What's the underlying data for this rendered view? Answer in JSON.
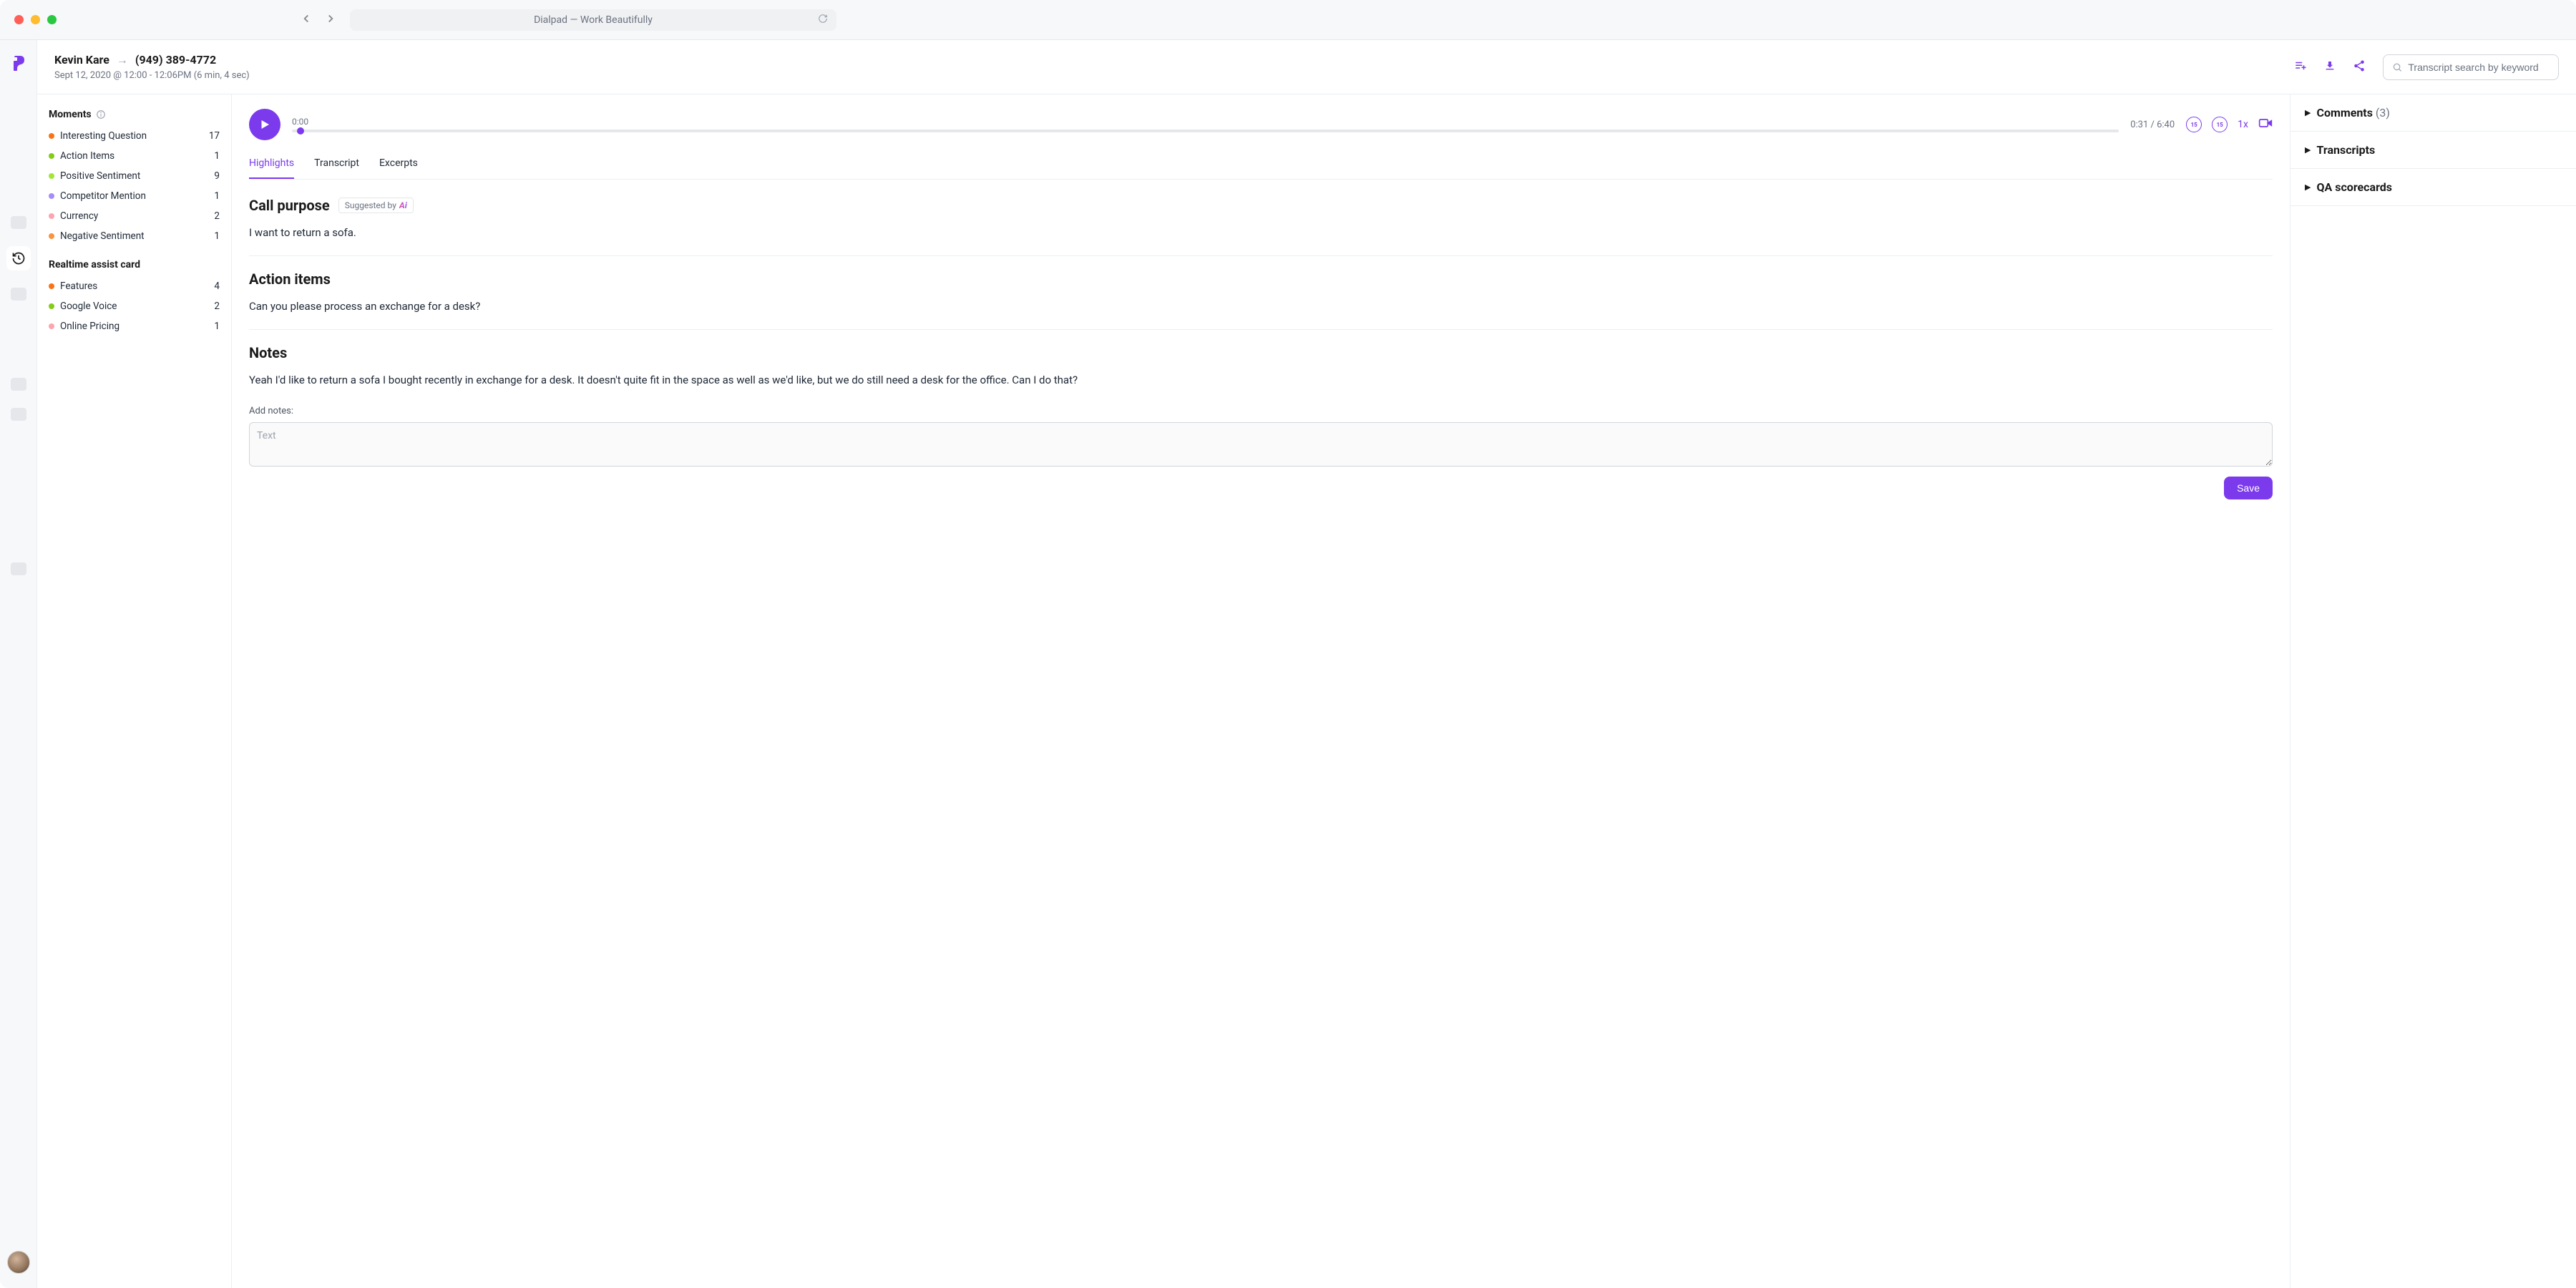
{
  "browser": {
    "title": "Dialpad — Work Beautifully"
  },
  "header": {
    "caller": "Kevin Kare",
    "recipient": "(949) 389-4772",
    "subtitle": "Sept 12, 2020 @ 12:00 - 12:06PM (6 min, 4 sec)",
    "search_placeholder": "Transcript search by keyword"
  },
  "colors": {
    "accent": "#7c3aed"
  },
  "moments": {
    "title": "Moments",
    "items": [
      {
        "label": "Interesting Question",
        "count": "17",
        "color": "#f97316"
      },
      {
        "label": "Action Items",
        "count": "1",
        "color": "#84cc16"
      },
      {
        "label": "Positive Sentiment",
        "count": "9",
        "color": "#a3e635"
      },
      {
        "label": "Competitor Mention",
        "count": "1",
        "color": "#a78bfa"
      },
      {
        "label": "Currency",
        "count": "2",
        "color": "#fda4af"
      },
      {
        "label": "Negative Sentiment",
        "count": "1",
        "color": "#fb923c"
      }
    ]
  },
  "assist": {
    "title": "Realtime assist card",
    "items": [
      {
        "label": "Features",
        "count": "4",
        "color": "#f97316"
      },
      {
        "label": "Google Voice",
        "count": "2",
        "color": "#84cc16"
      },
      {
        "label": "Online Pricing",
        "count": "1",
        "color": "#fda4af"
      }
    ]
  },
  "player": {
    "current_time": "0:00",
    "elapsed_total": "0:31 / 6:40",
    "skip_back": "15",
    "skip_fwd": "15",
    "speed": "1x"
  },
  "tabs": [
    {
      "label": "Highlights",
      "active": true
    },
    {
      "label": "Transcript",
      "active": false
    },
    {
      "label": "Excerpts",
      "active": false
    }
  ],
  "highlights": {
    "call_purpose": {
      "title": "Call purpose",
      "badge_prefix": "Suggested by ",
      "badge_ai": "Ai",
      "text": "I want to return a sofa."
    },
    "action_items": {
      "title": "Action items",
      "text": "Can you please process an exchange for a desk?"
    },
    "notes": {
      "title": "Notes",
      "text": "Yeah I'd like to return a sofa I bought recently in exchange for a desk. It doesn't quite fit in the space as well as we'd like, but we do still need a desk for the office. Can I do that?",
      "add_label": "Add notes:",
      "placeholder": "Text",
      "save": "Save"
    }
  },
  "rside": {
    "comments": {
      "label": "Comments",
      "count": "(3)"
    },
    "transcripts": "Transcripts",
    "qa": "QA scorecards"
  }
}
